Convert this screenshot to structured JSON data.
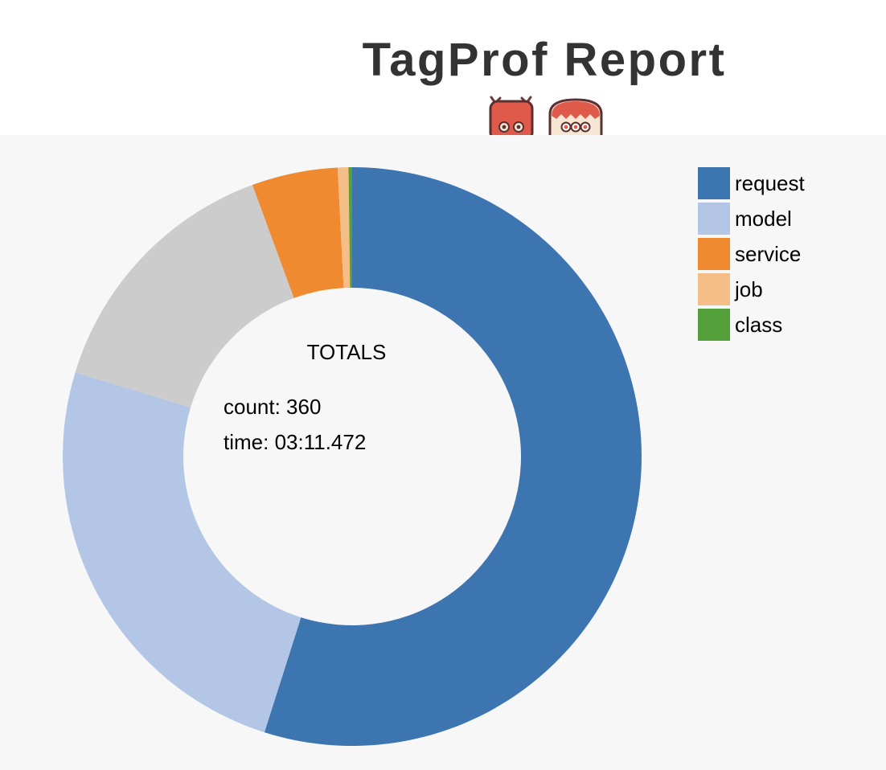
{
  "page": {
    "title": "TagProf Report"
  },
  "colors": {
    "request": "#3d75b0",
    "model": "#b3c6e6",
    "service": "#ef8a31",
    "job": "#f5be86",
    "class": "#54a13b",
    "other": "#cccccc",
    "panel_background": "#f7f7f7",
    "logo_red": "#e05a4b"
  },
  "icons": [
    "robot-antennae-icon",
    "robot-helmet-icon"
  ],
  "chart_data": {
    "type": "pie",
    "variant": "donut",
    "title": "TagProf Report",
    "center": {
      "heading": "TOTALS",
      "count_line": "count: 360",
      "time_line": "time: 03:11.472"
    },
    "legend": {
      "position": "top-right",
      "entries": [
        "request",
        "model",
        "service",
        "job",
        "class"
      ]
    },
    "slices": [
      {
        "label": "request",
        "value": 54.9
      },
      {
        "label": "model",
        "value": 24.8
      },
      {
        "label": "",
        "value": 14.7
      },
      {
        "label": "service",
        "value": 4.8
      },
      {
        "label": "job",
        "value": 0.6
      },
      {
        "label": "class",
        "value": 0.2
      }
    ]
  }
}
